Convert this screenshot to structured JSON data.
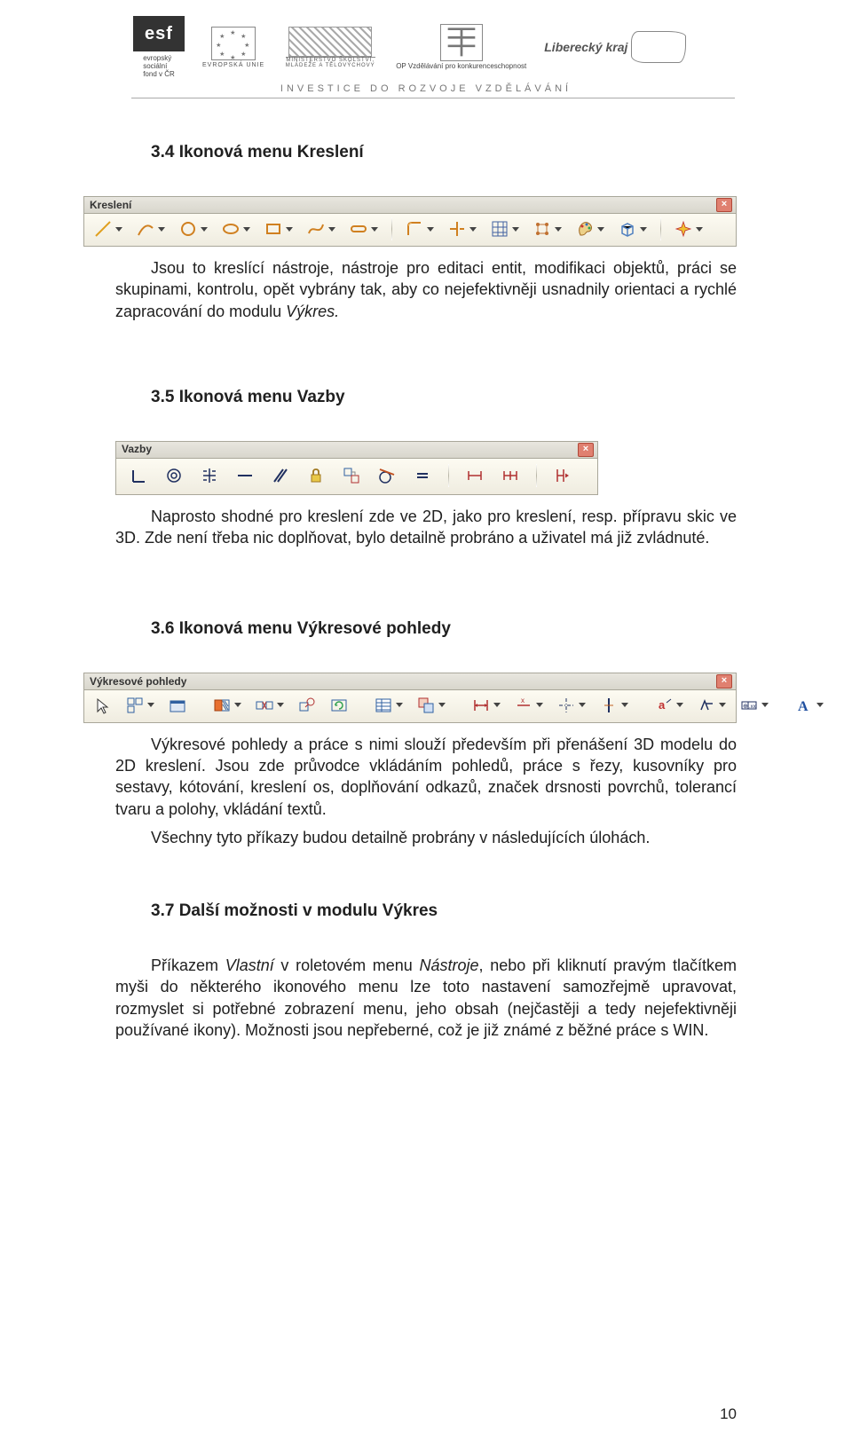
{
  "header": {
    "esf_label": "esf",
    "esf_small": "evropský\nsociální\nfond v ČR",
    "eu_label": "EVROPSKÁ UNIE",
    "msmt_label": "MINISTERSTVO ŠKOLSTVÍ,\nMLÁDEŽE A TĚLOVÝCHOVY",
    "op_small": "OP Vzdělávání\npro konkurenceschopnost",
    "kraj_label": "Liberecký kraj",
    "subtitle": "INVESTICE DO ROZVOJE VZDĚLÁVÁNÍ"
  },
  "section34": {
    "title": "3.4 Ikonová menu Kreslení",
    "toolbar_title": "Kreslení",
    "para1": "Jsou to kreslící nástroje, nástroje pro editaci entit, modifikaci objektů, práci se skupinami, kontrolu, opět vybrány tak, aby co nejefektivněji usnadnily orientaci a rychlé zapracování do modulu ",
    "para1_em": "Výkres."
  },
  "section35": {
    "title": "3.5 Ikonová menu Vazby",
    "toolbar_title": "Vazby",
    "para1": "Naprosto shodné pro kreslení zde ve 2D, jako pro kreslení, resp. přípravu skic ve 3D. Zde není třeba nic doplňovat, bylo detailně probráno a uživatel má již zvládnuté."
  },
  "section36": {
    "title": "3.6 Ikonová menu Výkresové pohledy",
    "toolbar_title": "Výkresové pohledy",
    "para1": "Výkresové pohledy a práce s nimi slouží především při přenášení 3D modelu do 2D kreslení. Jsou zde průvodce vkládáním pohledů, práce s řezy, kusovníky pro sestavy, kótování, kreslení os, doplňování odkazů, značek drsnosti povrchů, tolerancí tvaru a polohy, vkládání textů.",
    "para2": "Všechny tyto příkazy budou detailně probrány v následujících úlohách."
  },
  "section37": {
    "title": "3.7 Další možnosti v modulu Výkres",
    "para1a": "Příkazem ",
    "para1_em": "Vlastní",
    "para1b": " v roletovém menu ",
    "para1_em2": "Nástroje",
    "para1c": ", nebo při kliknutí pravým tlačítkem myši do některého ikonového menu lze toto nastavení samozřejmě upravovat, rozmyslet si potřebné zobrazení menu, jeho obsah (nejčastěji a tedy nejefektivněji používané ikony). Možnosti jsou nepřeberné, což je již známé z běžné práce s WIN."
  },
  "page_number": "10"
}
